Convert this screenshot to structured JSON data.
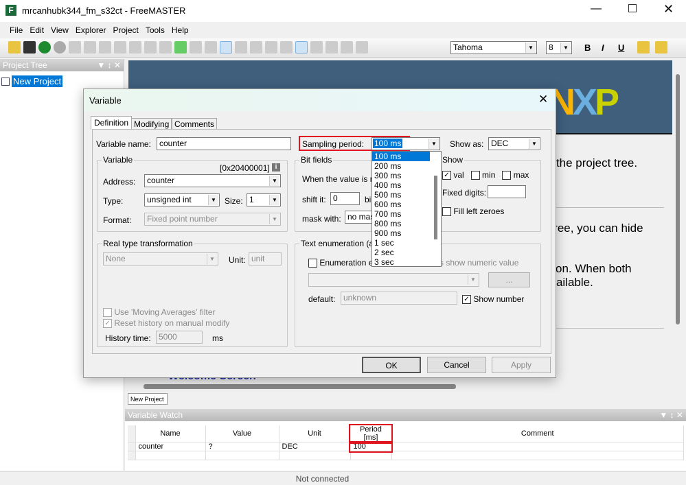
{
  "window": {
    "title": "mrcanhubk344_fm_s32ct - FreeMASTER"
  },
  "menu": [
    "File",
    "Edit",
    "View",
    "Explorer",
    "Project",
    "Tools",
    "Help"
  ],
  "toolbar": {
    "font": "Tahoma",
    "size": "8",
    "bold": "B",
    "italic": "I",
    "underline": "U"
  },
  "project_tree": {
    "title": "Project Tree",
    "items": [
      "New Project"
    ]
  },
  "welcome": {
    "lines": [
      "in the project tree.",
      "t tree, you can hide",
      "ction. When both",
      "available."
    ],
    "heading": "Welcome Screen",
    "logo": "NXP",
    "tab": "New Project"
  },
  "dialog": {
    "title": "Variable",
    "tabs": [
      "Definition",
      "Modifying",
      "Comments"
    ],
    "variable_name_label": "Variable name:",
    "variable_name": "counter",
    "sampling_label": "Sampling period:",
    "sampling_value": "100 ms",
    "sampling_options": [
      "100 ms",
      "200 ms",
      "300 ms",
      "400 ms",
      "500 ms",
      "600 ms",
      "700 ms",
      "800 ms",
      "900 ms",
      "1 sec",
      "2 sec",
      "3 sec"
    ],
    "show_as_label": "Show as:",
    "show_as": "DEC",
    "variable_group": {
      "title": "Variable",
      "address_hex": "[0x20400001]",
      "address_label": "Address:",
      "address": "counter",
      "type_label": "Type:",
      "type": "unsigned int",
      "size_label": "Size:",
      "size": "1",
      "format_label": "Format:",
      "format": "Fixed point number"
    },
    "bitfields": {
      "title": "Bit fields",
      "desc": "When the value is re",
      "shift_label": "shift it:",
      "shift": "0",
      "bits": "bi",
      "mask_label": "mask with:",
      "mask": "no mas"
    },
    "show": {
      "title": "Show",
      "val": "val",
      "min": "min",
      "max": "max",
      "fixed_digits": "Fixed digits:",
      "fill_zeroes": "Fill left zeroes"
    },
    "real_type": {
      "title": "Real type transformation",
      "value": "None",
      "unit_label": "Unit:",
      "unit": "unit",
      "moving_avg": "Use 'Moving Averages' filter",
      "reset_history": "Reset history on manual modify",
      "history_label": "History time:",
      "history": "5000",
      "ms": "ms"
    },
    "text_enum": {
      "title": "Text enumeration (a",
      "enum_label": "Enumeration e",
      "numeric": "s show numeric value",
      "browse": "...",
      "default_label": "default:",
      "default": "unknown",
      "show_number": "Show number"
    },
    "buttons": {
      "ok": "OK",
      "cancel": "Cancel",
      "apply": "Apply"
    }
  },
  "watch": {
    "title": "Variable Watch",
    "columns": [
      "Name",
      "Value",
      "Unit",
      "Period [ms]",
      "Comment"
    ],
    "rows": [
      [
        "counter",
        "?",
        "DEC",
        "100",
        ""
      ]
    ]
  },
  "status": "Not connected",
  "colors": {
    "banner": "#3f5f7d",
    "highlight": "#0078d7",
    "annotation": "#e0141e"
  }
}
